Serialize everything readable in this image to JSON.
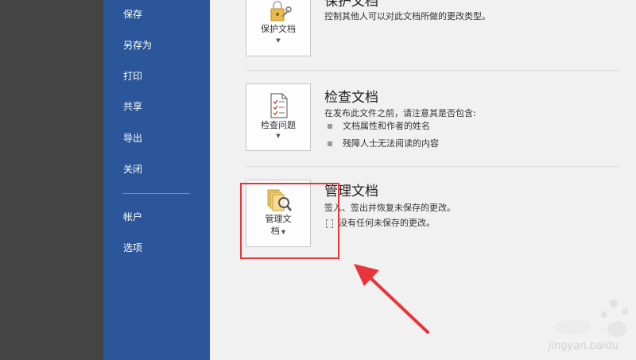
{
  "sidebar": {
    "items": [
      {
        "label": "保存"
      },
      {
        "label": "另存为"
      },
      {
        "label": "打印"
      },
      {
        "label": "共享"
      },
      {
        "label": "导出"
      },
      {
        "label": "关闭"
      },
      {
        "label": "帐户"
      },
      {
        "label": "选项"
      }
    ]
  },
  "sections": {
    "protect": {
      "title": "保护文档",
      "description": "控制其他人可以对此文档所做的更改类型。",
      "button_label": "保护文档",
      "icon": "lock-key-icon"
    },
    "inspect": {
      "title": "检查文档",
      "description": "在发布此文件之前，请注意其是否包含:",
      "bullets": [
        "文档属性和作者的姓名",
        "残障人士无法阅读的内容"
      ],
      "button_label": "检查问题",
      "icon": "inspect-checklist-icon"
    },
    "manage": {
      "title": "管理文档",
      "description": "签入、签出并恢复未保存的更改。",
      "status": "没有任何未保存的更改。",
      "button_label_line1": "管理文",
      "button_label_line2": "档",
      "icon": "manage-document-icon"
    }
  },
  "caret": "▼",
  "watermark": {
    "text": "jingyan.baidu"
  },
  "colors": {
    "sidebar_bg": "#2b579a",
    "left_strip": "#444444",
    "main_bg": "#f1f1f1",
    "annotation_red": "#e8343a"
  }
}
